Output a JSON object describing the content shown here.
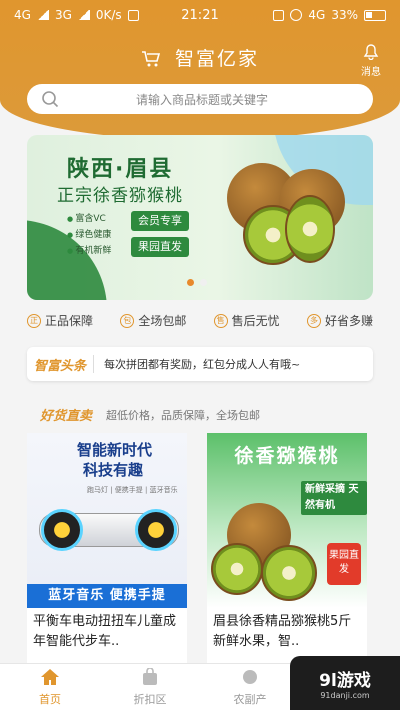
{
  "status_bar": {
    "network_left": "4G",
    "network_mid": "3G",
    "speed": "0K/s",
    "time": "21:21",
    "network_right": "4G",
    "battery": "33%"
  },
  "header": {
    "title": "智富亿家",
    "message_label": "消息"
  },
  "search": {
    "placeholder": "请输入商品标题或关键字"
  },
  "banner": {
    "headline": "陕西·眉县",
    "subheadline": "正宗徐香猕猴桃",
    "features": [
      "富含VC",
      "绿色健康",
      "有机新鲜"
    ],
    "tags": [
      "会员专享",
      "果园直发"
    ],
    "slide_count": 2,
    "active_slide": 0
  },
  "badges": [
    {
      "icon": "正",
      "label": "正品保障"
    },
    {
      "icon": "包",
      "label": "全场包邮"
    },
    {
      "icon": "售",
      "label": "售后无忧"
    },
    {
      "icon": "多",
      "label": "好省多赚"
    }
  ],
  "news": {
    "label": "智富头条",
    "text": "每次拼团都有奖励，红包分成人人有哦~"
  },
  "section": {
    "title": "好货直卖",
    "subtitle": "超低价格，品质保障，全场包邮"
  },
  "products": [
    {
      "img_line1": "智能新时代",
      "img_line2": "科技有趣",
      "img_line3": "跑马灯 | 便携手提 | 蓝牙音乐",
      "img_strip": "蓝牙音乐  便携手提",
      "name": "平衡车电动扭扭车儿童成年智能代步车.."
    },
    {
      "img_line1": "徐香猕猴桃",
      "img_line2": "新鲜采摘 天然有机",
      "img_tag": "果园直发",
      "name": "眉县徐香精品猕猴桃5斤 新鲜水果，智.."
    }
  ],
  "tabbar": [
    {
      "label": "首页",
      "active": true
    },
    {
      "label": "折扣区",
      "active": false
    },
    {
      "label": "农副产",
      "active": false
    }
  ],
  "watermark": {
    "brand": "9l游戏",
    "url": "91danji.com"
  },
  "colors": {
    "accent": "#e0962e",
    "banner_green": "#2e8a3e",
    "strip_blue": "#1a6fd6",
    "tag_red": "#e23b2a"
  }
}
